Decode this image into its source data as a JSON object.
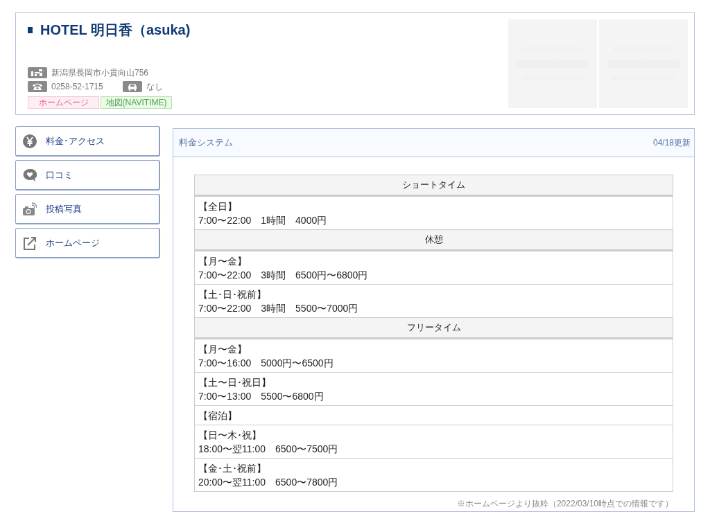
{
  "hotel": {
    "title": "HOTEL 明日香（asuka)",
    "address": "新潟県長岡市小貫向山756",
    "phone": "0258-52-1715",
    "parking": "なし",
    "links": [
      {
        "label": "ホームページ",
        "kind": "homepage"
      },
      {
        "label": "地図(NAVITIME)",
        "kind": "map"
      }
    ]
  },
  "sidebar": {
    "items": [
      {
        "label": "料金･アクセス",
        "kind": "fees"
      },
      {
        "label": "口コミ",
        "kind": "reviews"
      },
      {
        "label": "投稿写真",
        "kind": "photos"
      },
      {
        "label": "ホームページ",
        "kind": "homepage"
      }
    ]
  },
  "panel": {
    "title": "料金システム",
    "updated": "04/18更新",
    "rows": [
      {
        "kind": "section",
        "text": "ショートタイム"
      },
      {
        "kind": "entry",
        "lines": [
          "【全日】",
          "7:00〜22:00　1時間　4000円"
        ]
      },
      {
        "kind": "section",
        "text": "休憩"
      },
      {
        "kind": "entry",
        "lines": [
          "【月〜金】",
          "7:00〜22:00　3時間　6500円〜6800円"
        ]
      },
      {
        "kind": "entry",
        "lines": [
          "【土･日･祝前】",
          "7:00〜22:00　3時間　5500〜7000円"
        ]
      },
      {
        "kind": "section",
        "text": "フリータイム"
      },
      {
        "kind": "entry",
        "lines": [
          "【月〜金】",
          "7:00〜16:00　5000円〜6500円"
        ]
      },
      {
        "kind": "entry",
        "lines": [
          "【土〜日･祝日】",
          "7:00〜13:00　5500〜6800円"
        ]
      },
      {
        "kind": "entry",
        "lines": [
          "【宿泊】"
        ]
      },
      {
        "kind": "entry",
        "lines": [
          "【日〜木･祝】",
          "18:00〜翌11:00　6500〜7500円"
        ]
      },
      {
        "kind": "entry",
        "lines": [
          "【金･土･祝前】",
          "20:00〜翌11:00　6500〜7800円"
        ]
      }
    ],
    "note": "※ホームページより抜粋（2022/03/10時点での情報です）"
  }
}
